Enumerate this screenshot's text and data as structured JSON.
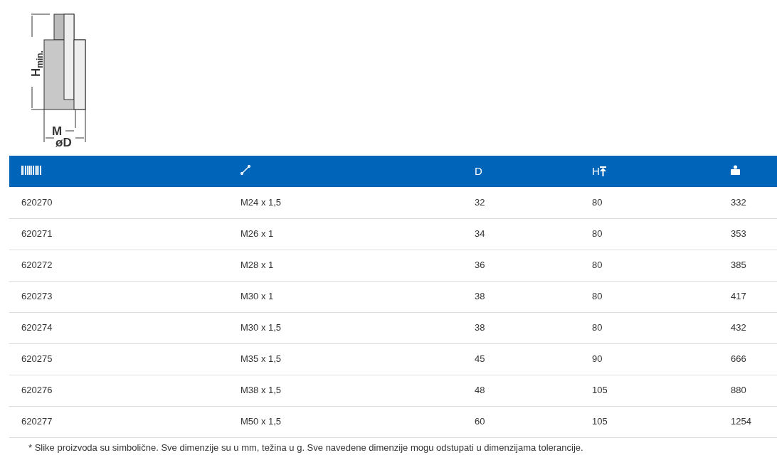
{
  "diagram": {
    "height_label": "H$_{min.}$",
    "thread_label": "M",
    "diameter_label": "øD"
  },
  "table": {
    "columns": [
      {
        "kind": "barcode",
        "text": ""
      },
      {
        "kind": "thread",
        "text": ""
      },
      {
        "kind": "text",
        "text": "D"
      },
      {
        "kind": "height",
        "text": "H"
      },
      {
        "kind": "weight",
        "text": ""
      }
    ],
    "rows": [
      [
        "620270",
        "M24 x 1,5",
        "32",
        "80",
        "332"
      ],
      [
        "620271",
        "M26 x 1",
        "34",
        "80",
        "353"
      ],
      [
        "620272",
        "M28 x 1",
        "36",
        "80",
        "385"
      ],
      [
        "620273",
        "M30 x 1",
        "38",
        "80",
        "417"
      ],
      [
        "620274",
        "M30 x 1,5",
        "38",
        "80",
        "432"
      ],
      [
        "620275",
        "M35 x 1,5",
        "45",
        "90",
        "666"
      ],
      [
        "620276",
        "M38 x 1,5",
        "48",
        "105",
        "880"
      ],
      [
        "620277",
        "M50 x 1,5",
        "60",
        "105",
        "1254"
      ]
    ]
  },
  "footnote": "* Slike proizvoda su simbolične. Sve dimenzije su u mm, težina u g. Sve navedene dimenzije mogu odstupati u dimenzijama tolerancije."
}
